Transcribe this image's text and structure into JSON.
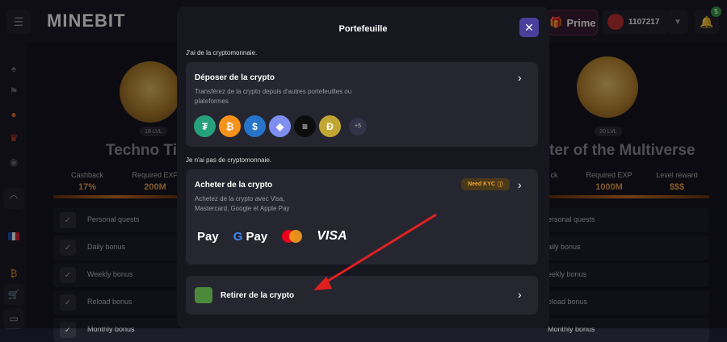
{
  "app": {
    "logo": "MINEBIT"
  },
  "header": {
    "prime_label": "Prime",
    "balance": "1107217",
    "notification_count": "5"
  },
  "sidebar": {
    "language": "French"
  },
  "background": {
    "left_badge": {
      "level": "18 LVL",
      "title": "Techno Ti"
    },
    "right_badge": {
      "level": "20 LVL",
      "title": "ter of the Multiverse"
    },
    "left_stats": [
      {
        "label": "Cashback",
        "value": "17%"
      },
      {
        "label": "Required EXP",
        "value": "200M"
      }
    ],
    "right_stats": [
      {
        "label": "ck",
        "value": ""
      },
      {
        "label": "Required EXP",
        "value": "1000M"
      },
      {
        "label": "Level reward",
        "value": "$$$"
      }
    ],
    "rows": [
      {
        "left": "Personal quests",
        "right": "ersonal quests"
      },
      {
        "left": "Daily bonus",
        "right": "aily bonus"
      },
      {
        "left": "Weekly bonus",
        "right": "eekly bonus"
      },
      {
        "left": "Reload bonus",
        "right": "eload bonus"
      },
      {
        "left": "Monthly bonus",
        "right": "Monthly bonus"
      }
    ]
  },
  "modal": {
    "title": "Portefeuille",
    "section_has_crypto": "J'ai de la cryptomonnaie.",
    "deposit": {
      "title": "Déposer de la crypto",
      "description": "Transférez de la crypto depuis d'autres portefeuilles ou plateformes",
      "coins": [
        {
          "name": "tether-icon",
          "symbol": "₮",
          "color": "#26a17b"
        },
        {
          "name": "bitcoin-icon",
          "symbol": "₿",
          "color": "#f7931a"
        },
        {
          "name": "usdc-icon",
          "symbol": "$",
          "color": "#2775ca"
        },
        {
          "name": "ethereum-icon",
          "symbol": "◆",
          "color": "#7f8ff0"
        },
        {
          "name": "solana-icon",
          "symbol": "≡",
          "color": "#0d0d0d"
        },
        {
          "name": "dogecoin-icon",
          "symbol": "Ð",
          "color": "#c2a633"
        }
      ],
      "more_label": "+5"
    },
    "section_no_crypto": "Je n'ai pas de cryptomonnaie.",
    "buy": {
      "title": "Acheter de la crypto",
      "description": "Achetez de la crypto avec Visa, Mastercard, Google et Apple Pay",
      "kyc_label": "Need KYC",
      "apple_pay": "Pay",
      "google_pay": "Pay",
      "visa": "VISA"
    },
    "withdraw": {
      "title": "Retirer de la crypto"
    }
  },
  "colors": {
    "accent": "#4a3f9a",
    "kyc": "#f0a030",
    "annotation_arrow": "#e02020"
  }
}
